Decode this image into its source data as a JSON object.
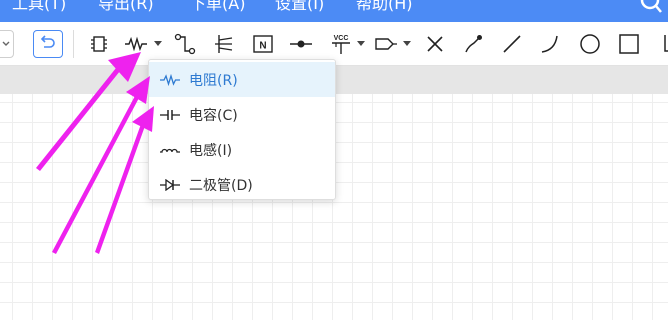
{
  "menubar": {
    "items": [
      "工具(T)",
      "导出(R)",
      "下单(A)",
      "设置(I)",
      "帮助(H)"
    ],
    "background": "#4c8bf5"
  },
  "toolbar": {
    "tools": [
      {
        "name": "chip-icon"
      },
      {
        "name": "resistor-icon",
        "has_dropdown": true
      },
      {
        "name": "wire-icon"
      },
      {
        "name": "transistor-icon"
      },
      {
        "name": "netlabel-icon",
        "text": "N"
      },
      {
        "name": "junction-icon"
      },
      {
        "name": "vcc-icon",
        "text": "VCC",
        "has_dropdown": true
      },
      {
        "name": "port-icon",
        "has_dropdown": true
      },
      {
        "name": "no-connect-icon"
      },
      {
        "name": "probe-icon"
      },
      {
        "name": "line-icon"
      },
      {
        "name": "arc-icon"
      },
      {
        "name": "circle-icon"
      },
      {
        "name": "rectangle-icon"
      }
    ],
    "accent": "#4a8af4"
  },
  "dropdown": {
    "items": [
      {
        "icon": "resistor-icon",
        "label": "电阻(R)",
        "active": true
      },
      {
        "icon": "capacitor-icon",
        "label": "电容(C)",
        "active": false
      },
      {
        "icon": "inductor-icon",
        "label": "电感(I)",
        "active": false
      },
      {
        "icon": "diode-icon",
        "label": "二极管(D)",
        "active": false
      }
    ],
    "active_color": "#2e7ad1",
    "active_background": "#e6f3fc"
  },
  "annotation": {
    "arrow_color": "#ee22ee",
    "arrow_count": 3
  }
}
